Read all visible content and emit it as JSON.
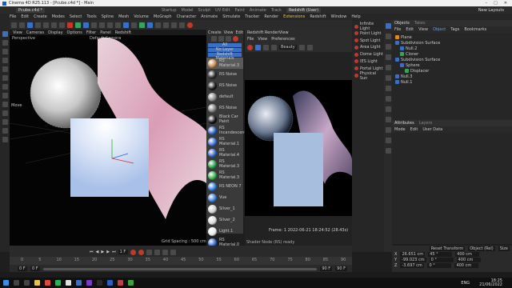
{
  "app": {
    "window_title": "Cinema 4D R25.113 - [Pcube.c4d *] - Main",
    "doc_tab": "Pcube.c4d *",
    "layout_tabs": [
      "Startup",
      "Model",
      "Sculpt",
      "UV Edit",
      "Paint",
      "Animate",
      "Track",
      "Redshift (User)"
    ],
    "active_layout": "Redshift (User)",
    "new_layouts_label": "New Layouts",
    "menu_items": [
      "File",
      "Edit",
      "Create",
      "Modes",
      "Select",
      "Tools",
      "Spline",
      "Mesh",
      "Volume",
      "MoGraph",
      "Character",
      "Animate",
      "Simulate",
      "Tracker",
      "Render",
      "Extensions",
      "Redshift",
      "Window",
      "Help"
    ]
  },
  "viewport": {
    "menu": [
      "View",
      "Cameras",
      "Display",
      "Options",
      "Filter",
      "Panel",
      "Redshift"
    ],
    "label": "Perspective",
    "camera": "Default Camera",
    "grid_spacing": "Grid Spacing : 500 cm",
    "left_label": "Move"
  },
  "materials": {
    "header_menu": [
      "Create",
      "View",
      "Edit"
    ],
    "filters": [
      "All",
      "No Layer",
      "Redshift Materials"
    ],
    "items": [
      {
        "name": "RS Material.3",
        "color": "#c98a4a"
      },
      {
        "name": "RS Noise",
        "color": "#2a2a2a"
      },
      {
        "name": "RS Noise",
        "color": "#1a1a1a"
      },
      {
        "name": "default",
        "color": "#888888"
      },
      {
        "name": "RS Noise",
        "color": "#7a7a7a"
      },
      {
        "name": "Black Car Paint",
        "color": "#111111"
      },
      {
        "name": "RS Incandescent",
        "color": "#2a5fbf"
      },
      {
        "name": "RS Material.1",
        "color": "#3a6fd0"
      },
      {
        "name": "RS Material.4",
        "color": "#2f64c8"
      },
      {
        "name": "RS Material.3",
        "color": "#28a048"
      },
      {
        "name": "RS Material.3",
        "color": "#35b050"
      },
      {
        "name": "RS NEON 7",
        "color": "#2d7ad8"
      },
      {
        "name": "Vue",
        "color": "#3c7fd8"
      },
      {
        "name": "Silver_1",
        "color": "#cfcfcf"
      },
      {
        "name": "Silver_2",
        "color": "#dadada"
      },
      {
        "name": "Light.1",
        "color": "#e8e8e8"
      },
      {
        "name": "RS Material.0",
        "color": "#3568c8"
      }
    ]
  },
  "render_view": {
    "title": "Redshift RenderView",
    "menu": [
      "File",
      "View",
      "Preferences"
    ],
    "dropdown": "Beauty",
    "frame_info": "Frame: 1   2022-06-21   18:24:52   (28.43s)",
    "status": "Shader Node (RS) ready"
  },
  "lights": {
    "items": [
      "Infinite Light",
      "Point Light",
      "Spot Light",
      "Area Light",
      "Dome Light",
      "IES Light",
      "Portal Light",
      "Physical Sun"
    ]
  },
  "objects": {
    "tabs": [
      "Objects",
      "Takes"
    ],
    "menu": [
      "File",
      "Edit",
      "View",
      "Object",
      "Tags",
      "Bookmarks"
    ],
    "tree": [
      {
        "name": "Plane",
        "indent": 0,
        "kind": "orange"
      },
      {
        "name": "Subdivision Surface",
        "indent": 0,
        "kind": "blue"
      },
      {
        "name": "Null.2",
        "indent": 1,
        "kind": "blue"
      },
      {
        "name": "Cloner",
        "indent": 1,
        "kind": "green"
      },
      {
        "name": "Subdivision Surface",
        "indent": 0,
        "kind": "blue"
      },
      {
        "name": "Sphere",
        "indent": 1,
        "kind": "blue"
      },
      {
        "name": "Displacer",
        "indent": 2,
        "kind": "green"
      },
      {
        "name": "Null.3",
        "indent": 0,
        "kind": "blue"
      },
      {
        "name": "Null.1",
        "indent": 0,
        "kind": "blue"
      }
    ]
  },
  "attributes": {
    "tabs": [
      "Attributes",
      "Layers"
    ],
    "menu": [
      "Mode",
      "Edit",
      "User Data"
    ]
  },
  "coordinates": {
    "header": [
      "Reset Transform",
      "Object (Rel)",
      "Size"
    ],
    "rows": [
      {
        "axis": "X",
        "pos": "26.651 cm",
        "rot": "45 °",
        "size": "400 cm"
      },
      {
        "axis": "Y",
        "pos": "-99.023 cm",
        "rot": "0 °",
        "size": "400 cm"
      },
      {
        "axis": "Z",
        "pos": "-3.697 cm",
        "rot": "0 °",
        "size": "400 cm"
      }
    ]
  },
  "timeline": {
    "current_frame": "1 F",
    "start": "0 F",
    "end": "90 F",
    "field_left": "0 F",
    "field_right": "90 F",
    "ticks": [
      "0",
      "5",
      "10",
      "15",
      "20",
      "25",
      "30",
      "35",
      "40",
      "45",
      "50",
      "55",
      "60",
      "65",
      "70",
      "75",
      "80",
      "85",
      "90"
    ]
  },
  "taskbar": {
    "time": "18:25",
    "date": "21/06/2022",
    "lang": "ENG"
  }
}
